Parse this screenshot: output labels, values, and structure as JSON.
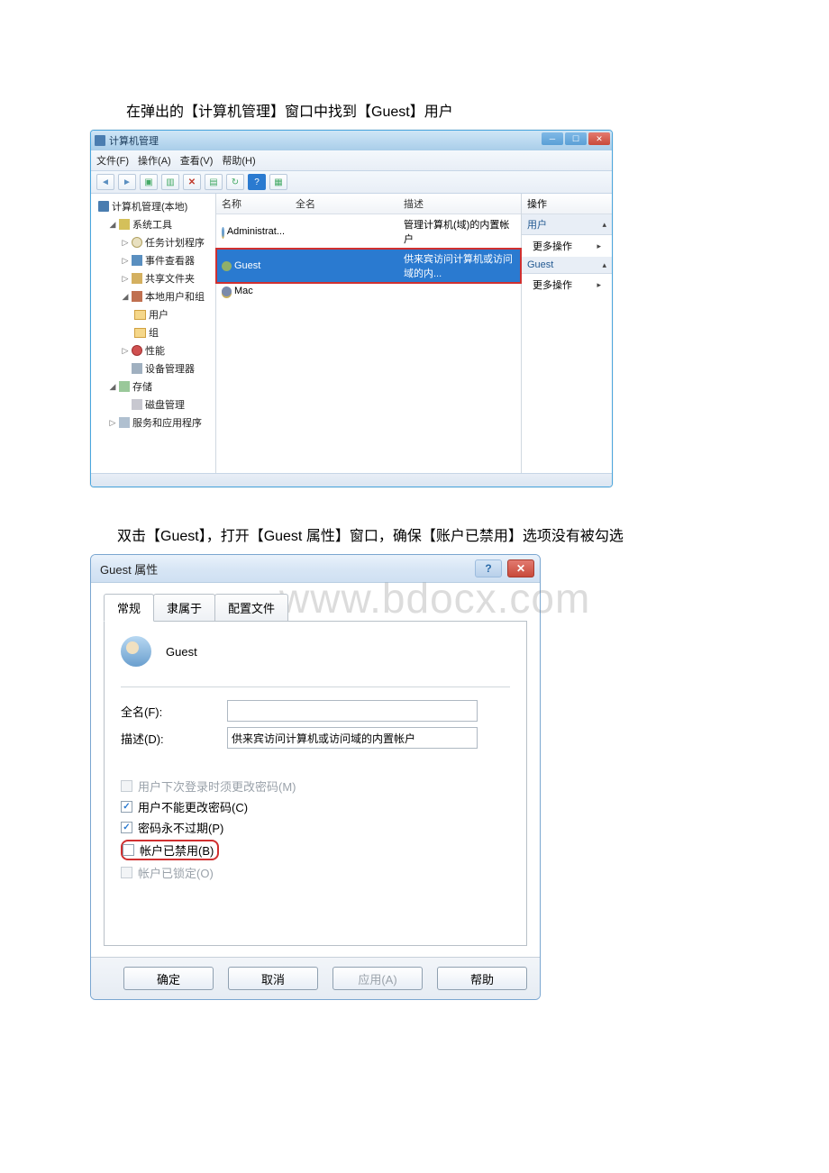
{
  "doc": {
    "instruction1": "在弹出的【计算机管理】窗口中找到【Guest】用户",
    "instruction2": "双击【Guest】，打开【Guest 属性】窗口，确保【账户已禁用】选项没有被勾选",
    "watermark": "www.bdocx.com"
  },
  "win1": {
    "title": "计算机管理",
    "menu": {
      "file": "文件(F)",
      "action": "操作(A)",
      "view": "查看(V)",
      "help": "帮助(H)"
    },
    "tree": {
      "root": "计算机管理(本地)",
      "systools": "系统工具",
      "sched": "任务计划程序",
      "event": "事件查看器",
      "share": "共享文件夹",
      "localusers": "本地用户和组",
      "users": "用户",
      "groups": "组",
      "perf": "性能",
      "devmgr": "设备管理器",
      "storage": "存储",
      "diskmgmt": "磁盘管理",
      "services": "服务和应用程序"
    },
    "columns": {
      "name": "名称",
      "fullname": "全名",
      "desc": "描述"
    },
    "rows": [
      {
        "name": "Administrat...",
        "fullname": "",
        "desc": "管理计算机(域)的内置帐户"
      },
      {
        "name": "Guest",
        "fullname": "",
        "desc": "供来宾访问计算机或访问域的内..."
      },
      {
        "name": "Mac",
        "fullname": "",
        "desc": ""
      }
    ],
    "actions": {
      "header": "操作",
      "sec1": "用户",
      "more": "更多操作",
      "sec2": "Guest"
    }
  },
  "win2": {
    "title": "Guest 属性",
    "tabs": {
      "general": "常规",
      "memberof": "隶属于",
      "profile": "配置文件"
    },
    "username": "Guest",
    "fullname_label": "全名(F):",
    "fullname_value": "",
    "desc_label": "描述(D):",
    "desc_value": "供来宾访问计算机或访问域的内置帐户",
    "chk": {
      "mustchange": "用户下次登录时须更改密码(M)",
      "cantchange": "用户不能更改密码(C)",
      "neverexpire": "密码永不过期(P)",
      "disabled": "帐户已禁用(B)",
      "locked": "帐户已锁定(O)"
    },
    "buttons": {
      "ok": "确定",
      "cancel": "取消",
      "apply": "应用(A)",
      "help": "帮助"
    }
  }
}
